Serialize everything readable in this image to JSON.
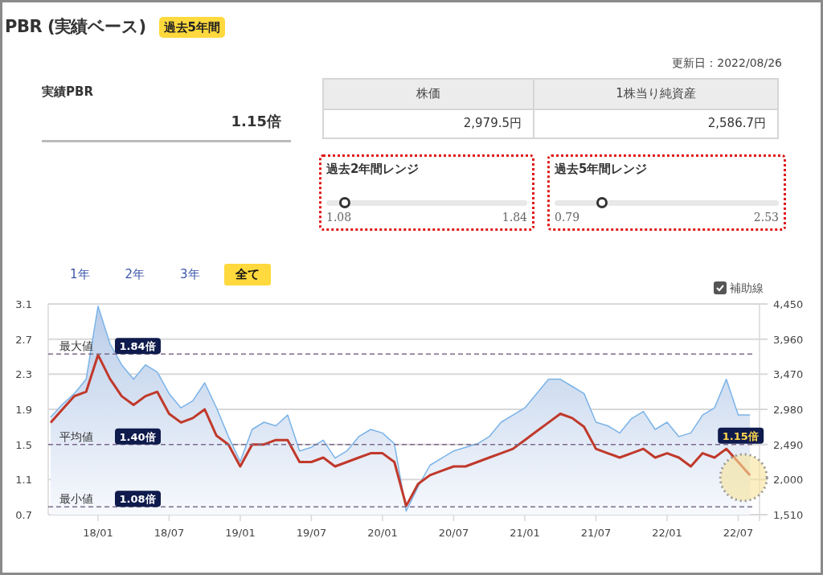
{
  "title": "PBR (実績ベース)",
  "period_badge": "過去5年間",
  "updated": "更新日：2022/08/26",
  "pbr": {
    "label": "実績PBR",
    "value": "1.15倍"
  },
  "table": {
    "columns": [
      "株価",
      "1株当り純資産"
    ],
    "rows": [
      [
        "2,979.5円",
        "2,586.7円"
      ]
    ]
  },
  "ranges": [
    {
      "title": "過去2年間レンジ",
      "min": "1.08",
      "max": "1.84",
      "level": 0.09
    },
    {
      "title": "過去5年間レンジ",
      "min": "0.79",
      "max": "2.53",
      "level": 0.21
    }
  ],
  "period_tabs": [
    {
      "label": "1年",
      "selected": false
    },
    {
      "label": "2年",
      "selected": false
    },
    {
      "label": "3年",
      "selected": false
    },
    {
      "label": "全て",
      "selected": true
    }
  ],
  "guide_lines": {
    "label": "補助線",
    "checked": true
  },
  "chart_data": {
    "type": "area",
    "grid": true,
    "categories": [
      null,
      null,
      null,
      null,
      "18/01",
      null,
      null,
      null,
      null,
      null,
      "18/07",
      null,
      null,
      null,
      null,
      null,
      "19/01",
      null,
      null,
      null,
      null,
      null,
      "19/07",
      null,
      null,
      null,
      null,
      null,
      "20/01",
      null,
      null,
      null,
      null,
      null,
      "20/07",
      null,
      null,
      null,
      null,
      null,
      "21/01",
      null,
      null,
      null,
      null,
      null,
      "21/07",
      null,
      null,
      null,
      null,
      null,
      "22/01",
      null,
      null,
      null,
      null,
      null,
      "22/07",
      null
    ],
    "ylim": [
      0.7,
      3.1
    ],
    "yticks": [
      {
        "value": 3.1,
        "label": "3.1"
      },
      {
        "value": 2.7,
        "label": "2.7"
      },
      {
        "value": 2.3,
        "label": "2.3"
      },
      {
        "value": 1.9,
        "label": "1.9"
      },
      {
        "value": 1.5,
        "label": "1.5"
      },
      {
        "value": 1.1,
        "label": "1.1"
      },
      {
        "value": 0.7,
        "label": "0.7"
      }
    ],
    "y2lim": [
      1510,
      4450
    ],
    "y2ticks": [
      {
        "value": 4450,
        "label": "4,450"
      },
      {
        "value": 3960,
        "label": "3,960"
      },
      {
        "value": 3470,
        "label": "3,470"
      },
      {
        "value": 2980,
        "label": "2,980"
      },
      {
        "value": 2490,
        "label": "2,490"
      },
      {
        "value": 2000,
        "label": "2,000"
      },
      {
        "value": 1510,
        "label": "1,510"
      }
    ],
    "series": [
      {
        "axis": "y2",
        "color": "#7ab3e8",
        "values": [
          2870,
          3050,
          3200,
          3400,
          4420,
          3900,
          3600,
          3400,
          3600,
          3500,
          3200,
          3000,
          3100,
          3350,
          3000,
          2600,
          2250,
          2700,
          2800,
          2750,
          2900,
          2400,
          2450,
          2550,
          2300,
          2400,
          2600,
          2700,
          2650,
          2500,
          1560,
          1900,
          2200,
          2300,
          2400,
          2450,
          2500,
          2600,
          2800,
          2900,
          3000,
          3200,
          3400,
          3400,
          3300,
          3200,
          2800,
          2750,
          2650,
          2850,
          2950,
          2700,
          2800,
          2600,
          2650,
          2900,
          3000,
          3400,
          2900,
          2900
        ]
      },
      {
        "type": "line",
        "color": "#c0392b",
        "values": [
          1.75,
          1.9,
          2.05,
          2.1,
          2.52,
          2.25,
          2.05,
          1.95,
          2.05,
          2.1,
          1.85,
          1.75,
          1.8,
          1.9,
          1.6,
          1.5,
          1.25,
          1.5,
          1.5,
          1.55,
          1.55,
          1.3,
          1.3,
          1.35,
          1.25,
          1.3,
          1.35,
          1.4,
          1.4,
          1.3,
          0.8,
          1.05,
          1.15,
          1.2,
          1.25,
          1.25,
          1.3,
          1.35,
          1.4,
          1.45,
          1.55,
          1.65,
          1.75,
          1.85,
          1.8,
          1.7,
          1.45,
          1.4,
          1.35,
          1.4,
          1.45,
          1.35,
          1.4,
          1.35,
          1.25,
          1.4,
          1.35,
          1.45,
          1.3,
          1.15
        ]
      }
    ],
    "ref_lines": [
      {
        "axis": "y",
        "value": 2.53,
        "label": "最大値"
      },
      {
        "axis": "y",
        "value": 1.5,
        "label": "平均値"
      },
      {
        "axis": "y",
        "value": 0.79,
        "label": "最小値"
      }
    ],
    "annotations": [
      "1.84倍",
      "1.40倍",
      "1.08倍",
      "1.15倍"
    ]
  }
}
